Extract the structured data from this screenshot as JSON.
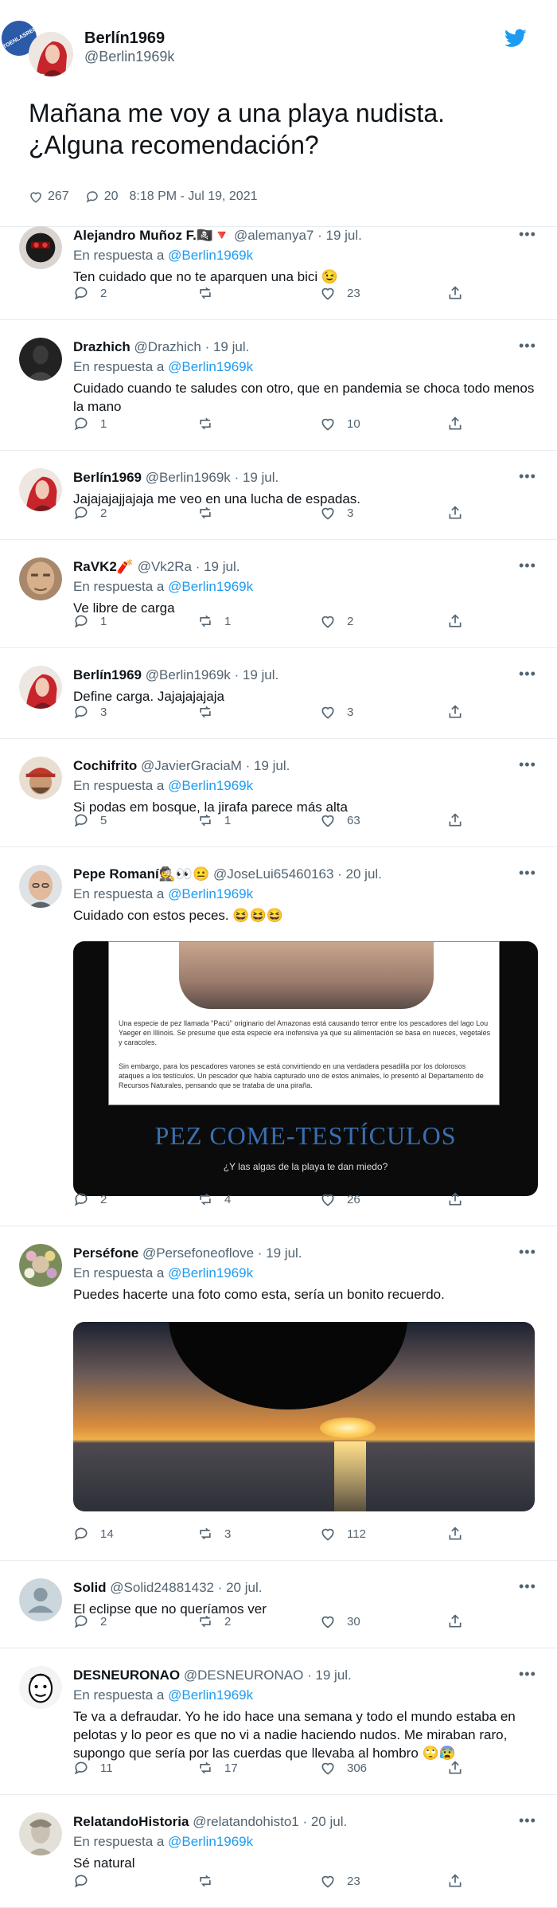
{
  "watermark": "VISTOENLASREDES",
  "main_tweet": {
    "name": "Berlín1969",
    "handle": "@Berlin1969k",
    "text_line1": "Mañana me voy a una playa nudista.",
    "text_line2": "¿Alguna recomendación?",
    "likes": "267",
    "replies": "20",
    "timestamp": "8:18 PM - Jul 19, 2021"
  },
  "in_reply_label": "En respuesta a",
  "reply_target": "@Berlin1969k",
  "replies": [
    {
      "name": "Alejandro Muñoz F.🏴‍☠️🔻",
      "handle": "@alemanya7 · 19 jul.",
      "text": "Ten cuidado que no te aparquen una bici 😉",
      "reply_count": "2",
      "retweets": "",
      "likes": "23"
    },
    {
      "name": "Drazhich",
      "handle": "@Drazhich · 19 jul.",
      "text": "Cuidado cuando te saludes con otro, que en pandemia se choca todo menos la mano",
      "reply_count": "1",
      "retweets": "",
      "likes": "10"
    },
    {
      "name": "Berlín1969",
      "handle": "@Berlin1969k · 19 jul.",
      "text": "Jajajajajjajaja me veo en una lucha de espadas.",
      "reply_count": "2",
      "retweets": "",
      "likes": "3"
    },
    {
      "name": "RaVK2🧨",
      "handle": "@Vk2Ra · 19 jul.",
      "text": "Ve libre de carga",
      "reply_count": "1",
      "retweets": "1",
      "likes": "2"
    },
    {
      "name": "Berlín1969",
      "handle": "@Berlin1969k · 19 jul.",
      "text": "Define carga. Jajajajajaja",
      "reply_count": "3",
      "retweets": "",
      "likes": "3"
    },
    {
      "name": "Cochifrito",
      "handle": "@JavierGraciaM · 19 jul.",
      "text": "Si podas em bosque, la jirafa parece más alta",
      "reply_count": "5",
      "retweets": "1",
      "likes": "63"
    },
    {
      "name": "Pepe Romaní🕵️👀😐",
      "handle": "@JoseLui65460163 · 20 jul.",
      "text": "Cuidado con estos peces. 😆😆😆",
      "reply_count": "2",
      "retweets": "4",
      "likes": "26"
    },
    {
      "name": "Perséfone",
      "handle": "@Persefoneoflove · 19 jul.",
      "text": "Puedes hacerte una foto como esta, sería un bonito recuerdo.",
      "reply_count": "14",
      "retweets": "3",
      "likes": "112"
    },
    {
      "name": "Solid",
      "handle": "@Solid24881432 · 20 jul.",
      "text": "El eclipse que no queríamos ver",
      "reply_count": "2",
      "retweets": "2",
      "likes": "30"
    },
    {
      "name": "DESNEURONAO",
      "handle": "@DESNEURONAO · 19 jul.",
      "text_line1": "Te va a defraudar. Yo he ido hace una semana y todo el mundo estaba en",
      "text_line2": "pelotas y lo peor es que no vi a nadie haciendo nudos. Me miraban raro,",
      "text_line3": "supongo que sería por las cuerdas que llevaba al hombro 🙄😰",
      "reply_count": "11",
      "retweets": "17",
      "likes": "306"
    },
    {
      "name": "RelatandoHistoria",
      "handle": "@relatandohisto1 · 20 jul.",
      "text": "Sé natural",
      "reply_count": "",
      "retweets": "",
      "likes": "23"
    }
  ],
  "fish_image": {
    "text1": "Una especie de pez llamada \"Pacú\" originario del Amazonas está causando terror entre los pescadores del lago Lou Yaeger en Illinois. Se presume que esta especie era inofensiva ya que su alimentación se basa en nueces, vegetales y caracoles.",
    "text2": "Sin embargo, para los pescadores varones se está convirtiendo en una verdadera pesadilla por los dolorosos ataques a los testículos. Un pescador que había capturado uno de estos animales, lo presentó al Departamento de Recursos Naturales, pensando que se trataba de una piraña.",
    "headline": "PEZ COME-TESTÍCULOS",
    "subline": "¿Y las algas de la playa te dan miedo?"
  },
  "colors": {
    "accent": "#1d9bf0",
    "muted": "#536471",
    "text": "#0f1419",
    "divider": "#e6ecf0"
  }
}
